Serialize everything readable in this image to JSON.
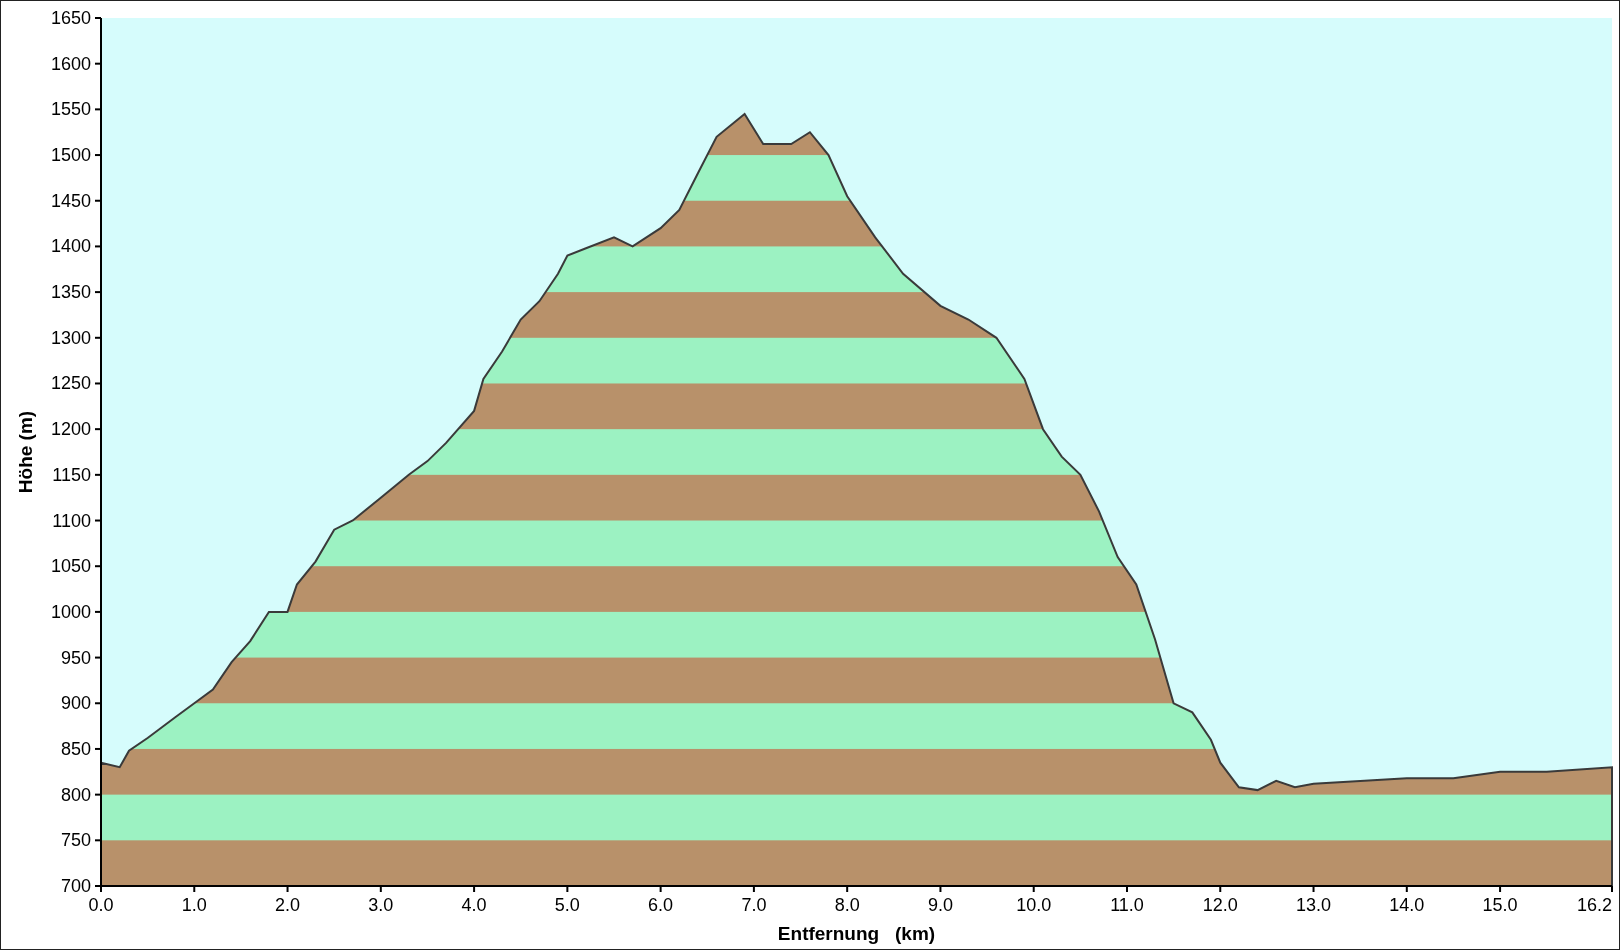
{
  "chart_data": {
    "type": "area",
    "xlabel": "Entfernung   (km)",
    "ylabel": "Höhe (m)",
    "x": [
      0,
      0.2,
      0.3,
      0.5,
      0.8,
      1.0,
      1.2,
      1.4,
      1.6,
      1.8,
      2.0,
      2.1,
      2.3,
      2.5,
      2.7,
      3.0,
      3.3,
      3.5,
      3.7,
      4.0,
      4.1,
      4.3,
      4.5,
      4.7,
      4.9,
      5.0,
      5.2,
      5.5,
      5.7,
      6.0,
      6.2,
      6.4,
      6.6,
      6.9,
      7.1,
      7.4,
      7.6,
      7.8,
      8.0,
      8.3,
      8.6,
      9.0,
      9.3,
      9.6,
      9.9,
      10.1,
      10.3,
      10.5,
      10.7,
      10.9,
      11.1,
      11.3,
      11.5,
      11.7,
      11.9,
      12.0,
      12.2,
      12.4,
      12.6,
      12.8,
      13.0,
      13.5,
      14.0,
      14.5,
      15.0,
      15.5,
      16.2
    ],
    "series": [
      {
        "color": "#3a3a3a",
        "values": [
          835,
          830,
          848,
          862,
          885,
          900,
          915,
          945,
          968,
          1000,
          1000,
          1030,
          1055,
          1090,
          1100,
          1125,
          1150,
          1165,
          1185,
          1220,
          1255,
          1285,
          1320,
          1340,
          1370,
          1390,
          1398,
          1410,
          1400,
          1420,
          1440,
          1480,
          1520,
          1545,
          1512,
          1512,
          1525,
          1500,
          1455,
          1410,
          1370,
          1335,
          1320,
          1300,
          1255,
          1200,
          1170,
          1150,
          1110,
          1060,
          1030,
          970,
          900,
          890,
          860,
          835,
          808,
          805,
          815,
          808,
          812,
          815,
          818,
          818,
          825,
          825,
          830
        ]
      }
    ],
    "xlim": [
      0,
      16.2
    ],
    "ylim": [
      700,
      1650
    ],
    "xticks": [
      {
        "value": 0,
        "label": "0.0"
      },
      {
        "value": 1,
        "label": "1.0"
      },
      {
        "value": 2,
        "label": "2.0"
      },
      {
        "value": 3,
        "label": "3.0"
      },
      {
        "value": 4,
        "label": "4.0"
      },
      {
        "value": 5,
        "label": "5.0"
      },
      {
        "value": 6,
        "label": "6.0"
      },
      {
        "value": 7,
        "label": "7.0"
      },
      {
        "value": 8,
        "label": "8.0"
      },
      {
        "value": 9,
        "label": "9.0"
      },
      {
        "value": 10,
        "label": "10.0"
      },
      {
        "value": 11,
        "label": "11.0"
      },
      {
        "value": 12,
        "label": "12.0"
      },
      {
        "value": 13,
        "label": "13.0"
      },
      {
        "value": 14,
        "label": "14.0"
      },
      {
        "value": 15,
        "label": "15.0"
      },
      {
        "value": 16.2,
        "label": "16.2"
      }
    ],
    "yticks": [
      700,
      750,
      800,
      850,
      900,
      950,
      1000,
      1050,
      1100,
      1150,
      1200,
      1250,
      1300,
      1350,
      1400,
      1450,
      1500,
      1550,
      1600,
      1650
    ]
  }
}
